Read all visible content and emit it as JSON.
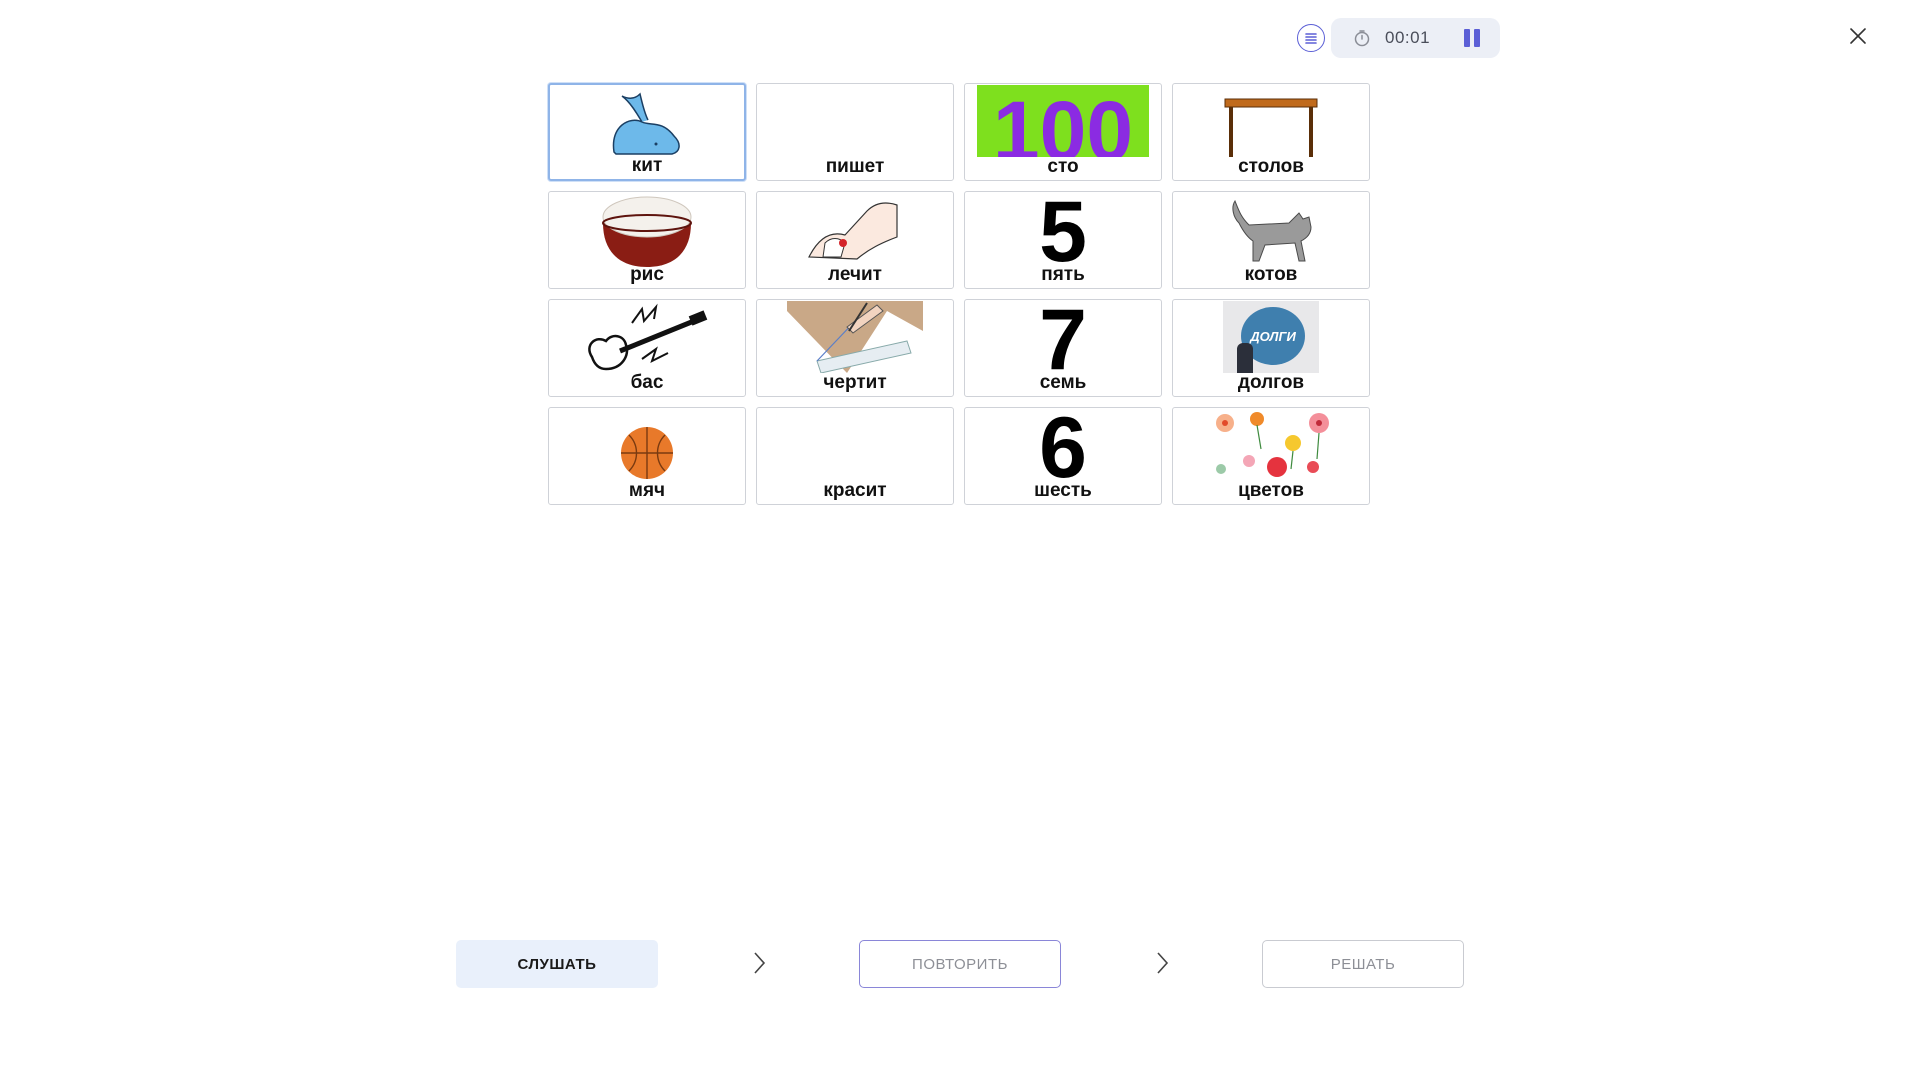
{
  "timer": {
    "value": "00:01"
  },
  "icons": {
    "menu": "list-icon",
    "timer": "stopwatch-icon",
    "pause": "pause-icon",
    "close": "close-icon",
    "chevron": "chevron-right-icon"
  },
  "colors": {
    "accent": "#5b5fd6",
    "selected_border": "#8fb4e8",
    "listen_bg": "#e9f0fb"
  },
  "cards": [
    {
      "word": "кит",
      "picture": "whale"
    },
    {
      "word": "пишет",
      "picture": ""
    },
    {
      "word": "сто",
      "picture": "number-100",
      "number": "100"
    },
    {
      "word": "столов",
      "picture": "table"
    },
    {
      "word": "рис",
      "picture": "rice-bowl"
    },
    {
      "word": "лечит",
      "picture": "bandaged-hand"
    },
    {
      "word": "пять",
      "picture": "number-5",
      "number": "5"
    },
    {
      "word": "котов",
      "picture": "cat"
    },
    {
      "word": "бас",
      "picture": "bass-guitar"
    },
    {
      "word": "чертит",
      "picture": "drawing-with-ruler"
    },
    {
      "word": "семь",
      "picture": "number-7",
      "number": "7"
    },
    {
      "word": "долгов",
      "picture": "debts-ball",
      "caption": "ДОЛГИ"
    },
    {
      "word": "мяч",
      "picture": "basketball"
    },
    {
      "word": "красит",
      "picture": ""
    },
    {
      "word": "шесть",
      "picture": "number-6",
      "number": "6"
    },
    {
      "word": "цветов",
      "picture": "flowers"
    }
  ],
  "steps": {
    "listen": "СЛУШАТЬ",
    "repeat": "ПОВТОРИТЬ",
    "solve": "РЕШАТЬ"
  }
}
